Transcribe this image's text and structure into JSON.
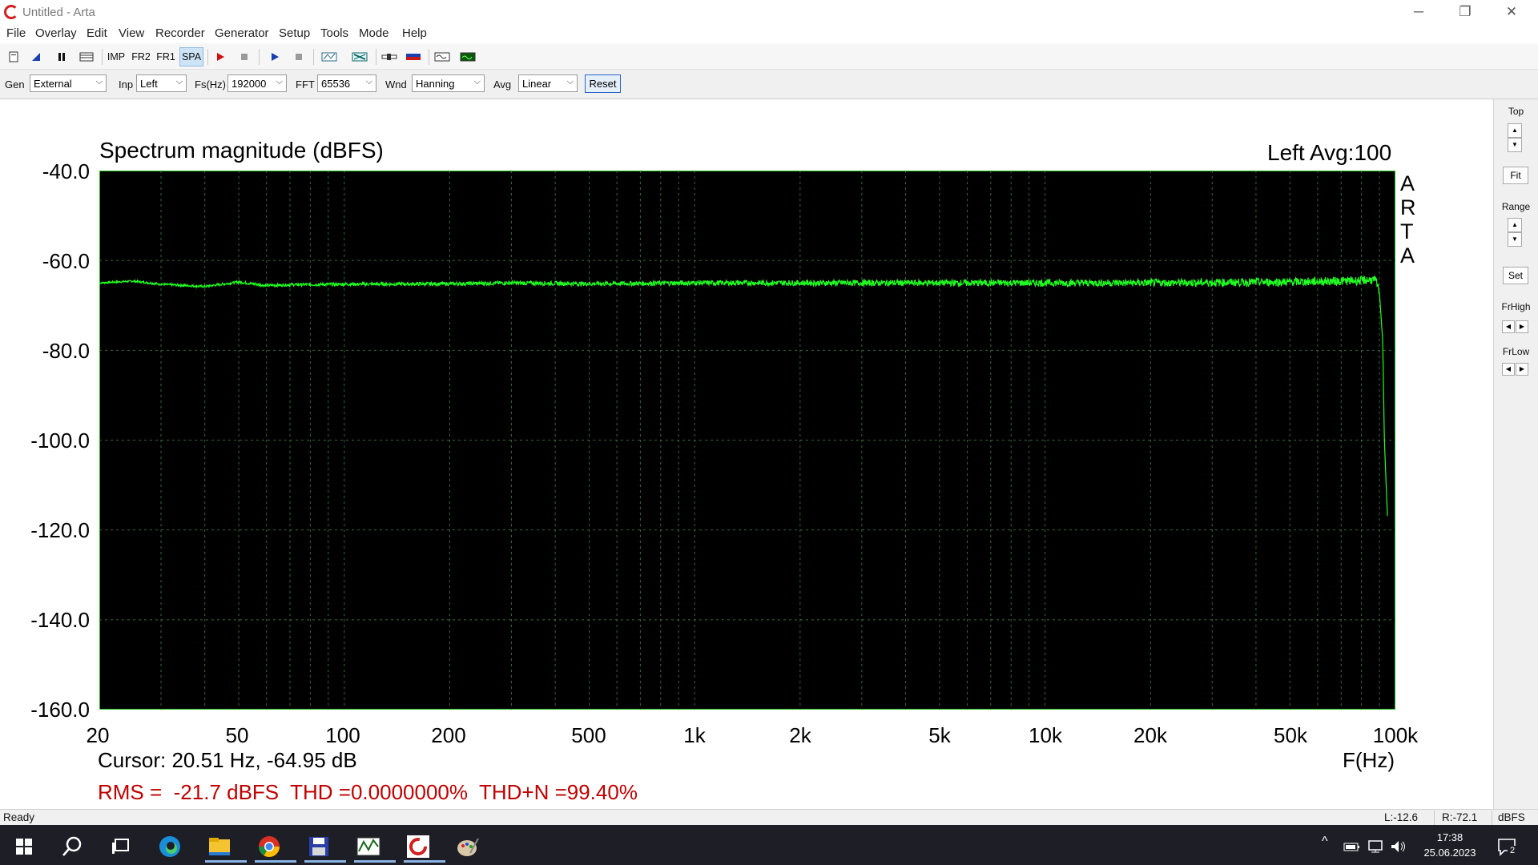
{
  "window": {
    "title": "Untitled - Arta"
  },
  "menu": [
    "File",
    "Overlay",
    "Edit",
    "View",
    "Recorder",
    "Generator",
    "Setup",
    "Tools",
    "Mode",
    "Help"
  ],
  "toolbar": {
    "imp": "IMP",
    "fr2": "FR2",
    "fr1": "FR1",
    "spa": "SPA"
  },
  "controls": {
    "gen_label": "Gen",
    "gen_value": "External",
    "inp_label": "Inp",
    "inp_value": "Left",
    "fs_label": "Fs(Hz)",
    "fs_value": "192000",
    "fft_label": "FFT",
    "fft_value": "65536",
    "wnd_label": "Wnd",
    "wnd_value": "Hanning",
    "avg_label": "Avg",
    "avg_value": "Linear",
    "reset_label": "Reset"
  },
  "chart_data": {
    "type": "line",
    "title": "Spectrum magnitude (dBFS)",
    "header_right": "Left  Avg:100",
    "watermark": [
      "A",
      "R",
      "T",
      "A"
    ],
    "xlabel": "F(Hz)",
    "x_scale": "log",
    "xlim": [
      20,
      100000
    ],
    "ylim": [
      -160,
      -40
    ],
    "x_ticks": [
      20,
      50,
      100,
      200,
      500,
      1000,
      2000,
      5000,
      10000,
      20000,
      50000,
      100000
    ],
    "x_tick_labels": [
      "20",
      "50",
      "100",
      "200",
      "500",
      "1k",
      "2k",
      "5k",
      "10k",
      "20k",
      "50k",
      "100k"
    ],
    "y_ticks": [
      -40,
      -60,
      -80,
      -100,
      -120,
      -140,
      -160
    ],
    "y_tick_labels": [
      "-40.0",
      "-60.0",
      "-80.0",
      "-100.0",
      "-120.0",
      "-140.0",
      "-160.0"
    ],
    "background": "#000000",
    "grid_color": "#3a6a3a",
    "trace_color": "#22ff22",
    "series": [
      {
        "x": [
          20,
          25,
          30,
          40,
          50,
          60,
          70,
          100,
          200,
          300,
          500,
          1000,
          2000,
          5000,
          10000,
          20000,
          50000,
          80000,
          85000,
          88000,
          90000,
          92000,
          93000,
          95000
        ],
        "y": [
          -65.0,
          -64.6,
          -65.3,
          -65.8,
          -64.8,
          -65.6,
          -65.4,
          -65.3,
          -65.2,
          -65.0,
          -65.2,
          -65.0,
          -65.0,
          -65.0,
          -65.0,
          -65.0,
          -64.8,
          -64.5,
          -64.3,
          -64.6,
          -67.0,
          -78.0,
          -100.0,
          -118.0
        ]
      }
    ],
    "cursor": "Cursor: 20.51 Hz, -64.95 dB",
    "metrics": "RMS =  -21.7 dBFS  THD =0.0000000%  THD+N =99.40%"
  },
  "side_panel": {
    "top_label": "Top",
    "up": "▲",
    "down": "▼",
    "fit": "Fit",
    "range_label": "Range",
    "set": "Set",
    "frhigh_label": "FrHigh",
    "frlow_label": "FrLow",
    "left_arrow": "◀",
    "right_arrow": "▶"
  },
  "status": {
    "ready": "Ready",
    "left_level": "L:-12.6",
    "right_level": "R:-72.1",
    "unit": "dBFS"
  },
  "taskbar": {
    "time": "17:38",
    "date": "25.06.2023",
    "notif_count": "2"
  },
  "glyphs": {
    "minimize": "─",
    "restore": "❐",
    "close": "✕",
    "chev": "⌵"
  }
}
